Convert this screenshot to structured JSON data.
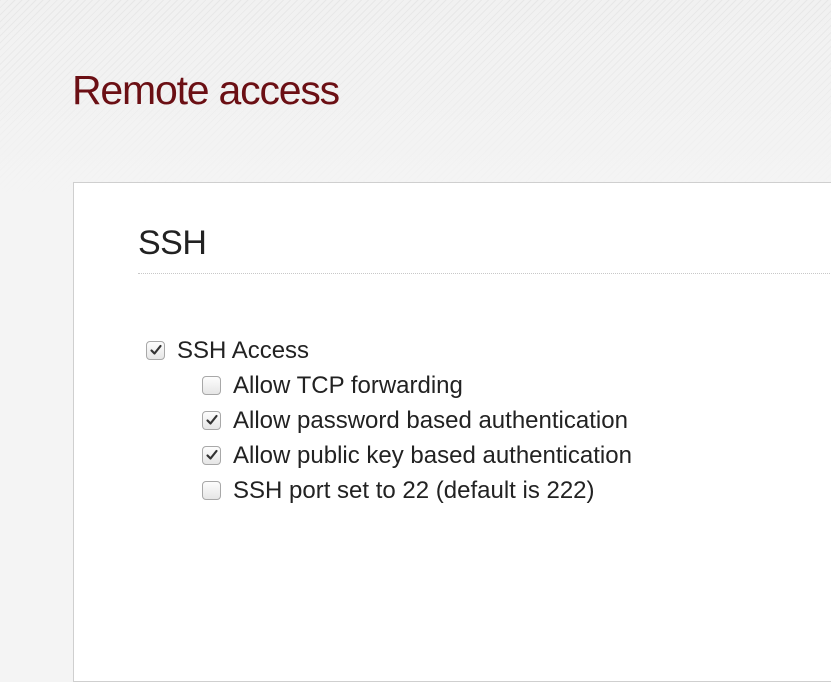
{
  "page": {
    "title": "Remote access"
  },
  "ssh": {
    "heading": "SSH",
    "options": [
      {
        "label": "SSH Access",
        "checked": true,
        "level": 0
      },
      {
        "label": "Allow TCP forwarding",
        "checked": false,
        "level": 1
      },
      {
        "label": "Allow password based authentication",
        "checked": true,
        "level": 1
      },
      {
        "label": "Allow public key based authentication",
        "checked": true,
        "level": 1
      },
      {
        "label": "SSH port set to 22 (default is 222)",
        "checked": false,
        "level": 1
      }
    ]
  },
  "colors": {
    "title": "#6b0f14",
    "text": "#222222",
    "panel_border": "#cfcfcf"
  }
}
